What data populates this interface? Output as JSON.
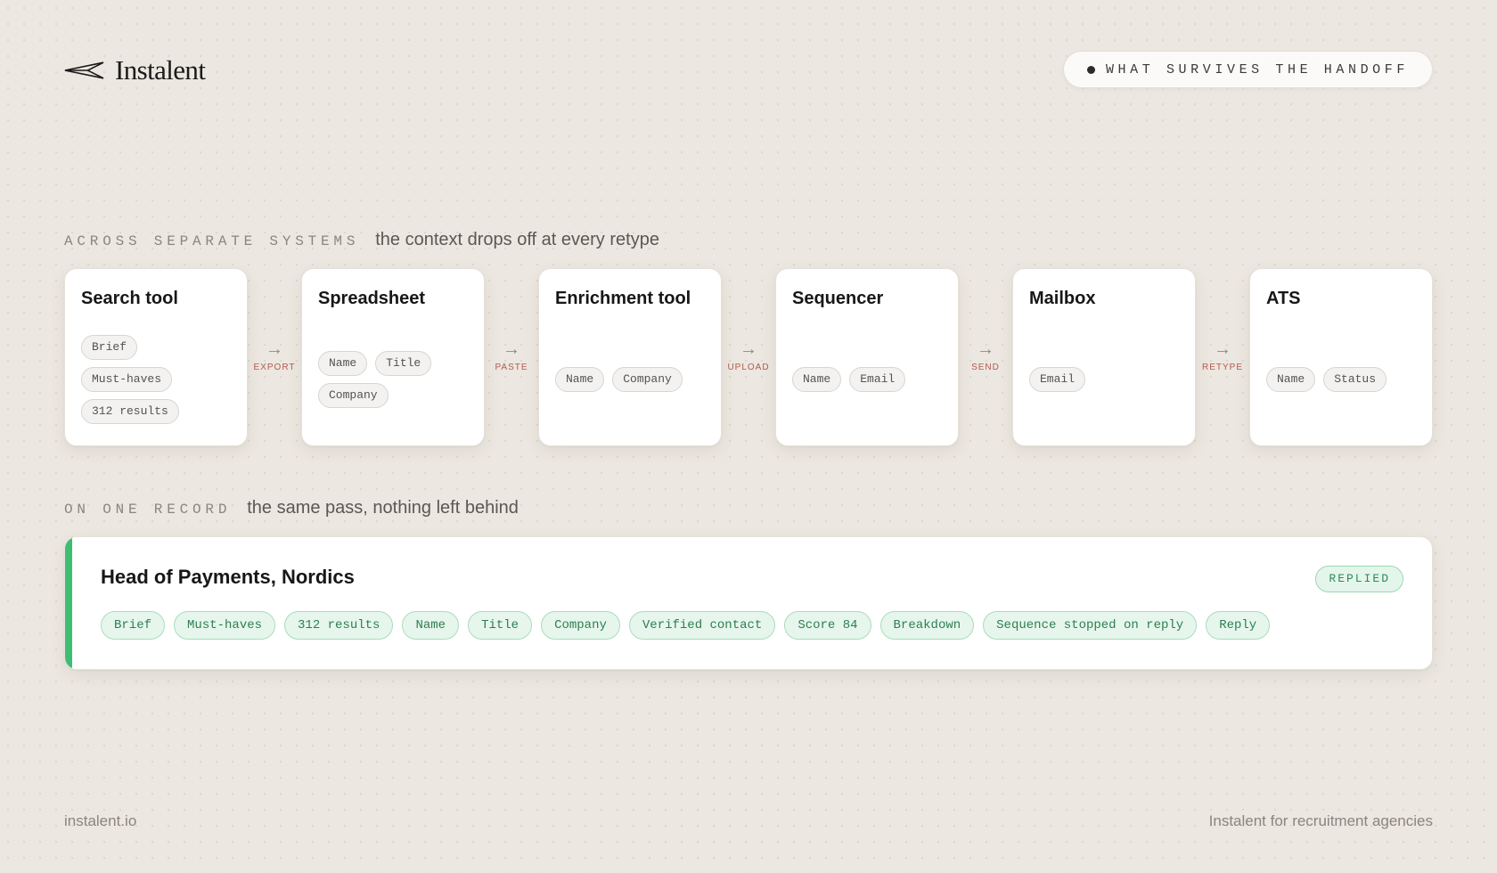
{
  "brand": {
    "name": "Instalent",
    "icon": "paper-plane-icon"
  },
  "badge": {
    "label": "WHAT SURVIVES THE HANDOFF",
    "color": "#2b2b2b"
  },
  "separate": {
    "kicker": "ACROSS SEPARATE SYSTEMS",
    "caption": "the context drops off at every retype",
    "arrow": "→",
    "systems": [
      {
        "name": "Search tool",
        "rows": [
          [
            "Brief"
          ],
          [
            "Must-haves"
          ],
          [
            "312 results"
          ]
        ]
      },
      {
        "name": "Spreadsheet",
        "rows": [
          [
            "Name",
            "Title"
          ],
          [
            "Company"
          ]
        ]
      },
      {
        "name": "Enrichment tool",
        "rows": [
          [
            "Name",
            "Company"
          ]
        ]
      },
      {
        "name": "Sequencer",
        "rows": [
          [
            "Name",
            "Email"
          ]
        ]
      },
      {
        "name": "Mailbox",
        "rows": [
          [
            "Email"
          ]
        ]
      },
      {
        "name": "ATS",
        "rows": [
          [
            "Name",
            "Status"
          ]
        ]
      }
    ],
    "handoffs": [
      "EXPORT",
      "PASTE",
      "UPLOAD",
      "SEND",
      "RETYPE"
    ]
  },
  "record_section": {
    "kicker": "ON ONE RECORD",
    "caption": "the same pass, nothing left behind",
    "title": "Head of Payments, Nordics",
    "status": "REPLIED",
    "accent_color": "#3fbd73",
    "fields": [
      "Brief",
      "Must-haves",
      "312 results",
      "Name",
      "Title",
      "Company",
      "Verified contact",
      "Score 84",
      "Breakdown",
      "Sequence stopped on reply",
      "Reply"
    ]
  },
  "footer": {
    "site": "instalent.io",
    "tagline": "Instalent for recruitment agencies"
  }
}
